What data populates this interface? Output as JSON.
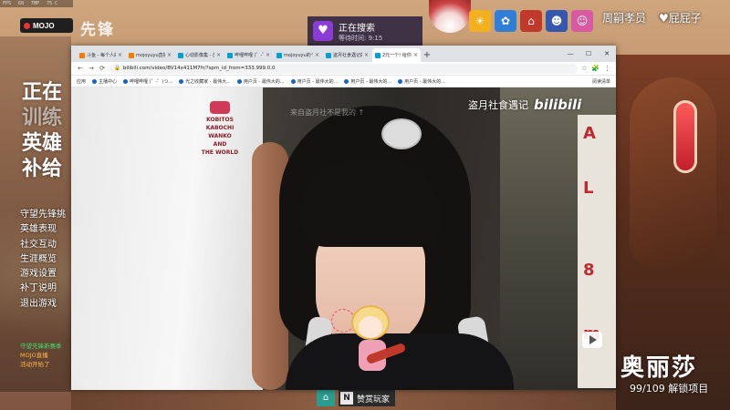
{
  "overlay": {
    "perf": [
      "FPS",
      "60",
      "TMP",
      "75 C"
    ],
    "mojo_badge": "MOJO",
    "logo_text": "先锋",
    "left_big": [
      "正在",
      "训练",
      "英雄",
      "补给"
    ],
    "left_menu": [
      "守望先锋挑",
      "英雄表现",
      "社交互动",
      "生涯概览",
      "游戏设置",
      "补丁说明",
      "退出游戏"
    ],
    "left_notes": [
      "守望先锋新赛季",
      "MOJO直播",
      "活动开始了"
    ],
    "search_toast": {
      "title": "正在搜索",
      "sub": "等待时间: 9:15"
    },
    "top_right_names": [
      "周嗣孝员",
      "屁屁子"
    ],
    "character_name": "奥丽莎",
    "unlock_progress": "99/109 解锁项目",
    "bottom_label": "赞赏玩家"
  },
  "browser": {
    "tabs": [
      {
        "label": "斗鱼 - 每个人的直播平台",
        "active": false
      },
      {
        "label": "mojoyuyu直播 A",
        "active": false
      },
      {
        "label": "心动影像集 - 创意",
        "active": false
      },
      {
        "label": "哔哩哔哩 (゜-゜)つ",
        "active": false
      },
      {
        "label": "mojoyuyu的个人空间",
        "active": false
      },
      {
        "label": "盗月社食遇记的个人",
        "active": false
      },
      {
        "label": "2元一个! 给你们尝",
        "active": true
      }
    ],
    "new_tab": "+",
    "window_controls": [
      "—",
      "☐",
      "✕"
    ],
    "nav": [
      "←",
      "→",
      "⟳"
    ],
    "url": "bilibili.com/video/BV14x411M7fr/?spm_id_from=333.999.0.0",
    "toolbar_icons": [
      "☆",
      "🧩",
      "⋮"
    ],
    "bookmarks": [
      "应用",
      "主播中心",
      "哔哩哔哩 (゜-゜)つ...",
      "光之收藏家 - 最伟大...",
      "用户页 - 最伟大的...",
      "用户页 - 最伟大的...",
      "用户页 - 最伟大的...",
      "用户页 - 最伟大的..."
    ],
    "bookmarks_right": "阅读清单"
  },
  "video": {
    "watermark_channel": "盗月社食遇记",
    "watermark_site": "bilibili",
    "shirt_text": [
      "KOBITOS",
      "KABOCHI",
      "WANKO",
      "AND",
      "THE WORLD"
    ],
    "overlay_faint": "盗月社食遇记",
    "overlay_faint2": "来自盗月社不是我的 ↑",
    "sign_chars": [
      "A",
      "L",
      "8",
      "m"
    ]
  },
  "colors": {
    "accent": "#00a1d6",
    "toast_bg": "#2a1e3c",
    "sign_red": "#c1272d"
  }
}
